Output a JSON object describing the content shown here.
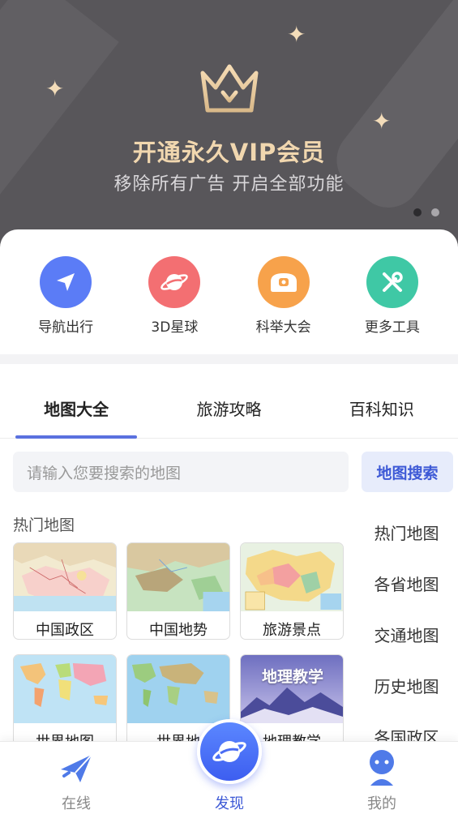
{
  "banner": {
    "title": "开通永久VIP会员",
    "subtitle": "移除所有广告 开启全部功能",
    "slide_count": 2,
    "active_slide": 1,
    "accent_color": "#f1d7af"
  },
  "tools": [
    {
      "label": "导航出行",
      "icon": "navigation-arrow-icon",
      "color": "#5b7cf6"
    },
    {
      "label": "3D星球",
      "icon": "planet-icon",
      "color": "#f36f72"
    },
    {
      "label": "科举大会",
      "icon": "exam-badge-icon",
      "color": "#f7a24b"
    },
    {
      "label": "更多工具",
      "icon": "tools-icon",
      "color": "#3fc8a5"
    }
  ],
  "tabs": [
    {
      "label": "地图大全",
      "active": true
    },
    {
      "label": "旅游攻略",
      "active": false
    },
    {
      "label": "百科知识",
      "active": false
    }
  ],
  "search": {
    "placeholder": "请输入您要搜索的地图",
    "button_label": "地图搜索"
  },
  "section": {
    "title": "热门地图"
  },
  "maps": [
    {
      "label": "中国政区",
      "thumb": "china-political-map"
    },
    {
      "label": "中国地势",
      "thumb": "china-terrain-map"
    },
    {
      "label": "旅游景点",
      "thumb": "china-tourism-map"
    },
    {
      "label": "世界地图",
      "thumb": "world-political-map"
    },
    {
      "label": "世界地",
      "thumb": "world-terrain-map"
    },
    {
      "label": "地理教学",
      "thumb": "geography-teaching-cover",
      "overlay": "地理教学"
    }
  ],
  "side_list": [
    "热门地图",
    "各省地图",
    "交通地图",
    "历史地图",
    "各国政区"
  ],
  "bottom_nav": {
    "online": "在线",
    "discover": "发现",
    "mine": "我的",
    "active_color": "#3d59d6"
  }
}
